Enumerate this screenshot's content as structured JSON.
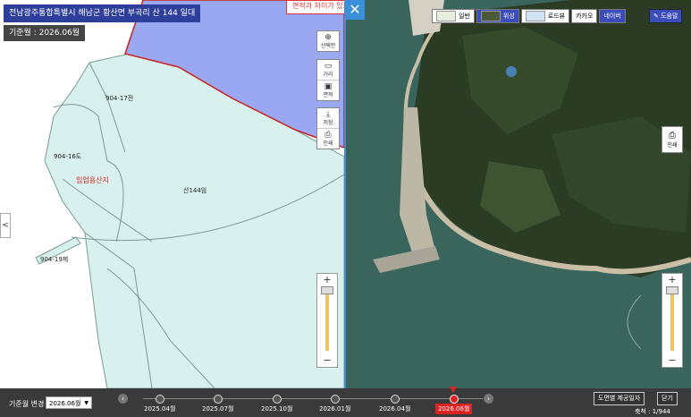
{
  "header": {
    "address": "전남광주통합특별시 해남군 황산면 부곡리 산 144 일대",
    "base_date": "기준월 : 2026.06월",
    "notice": "면적과 차이가 있으"
  },
  "left_tools": [
    {
      "name": "select-tool",
      "label": "선택안",
      "icon": "⊕"
    },
    {
      "name": "distance-tool",
      "label": "거리",
      "icon": "▭"
    },
    {
      "name": "area-tool",
      "label": "면적",
      "icon": "▣"
    },
    {
      "name": "save-tool",
      "label": "저장",
      "icon": "⤓"
    },
    {
      "name": "print-tool",
      "label": "인쇄",
      "icon": "⎙"
    }
  ],
  "map_labels": {
    "p1": "904-17전",
    "p2": "904-16도",
    "p3": "산144임",
    "p4": "904-19제",
    "zone": "임업용산지"
  },
  "map_types": [
    {
      "label": "일반",
      "thumb": "#e8ede0",
      "active": false
    },
    {
      "label": "위성",
      "thumb": "#4a5a3a",
      "active": true
    },
    {
      "label": "로드뷰",
      "thumb": "#cfe3f5",
      "active": false
    },
    {
      "label": "카카오",
      "thumb": "",
      "active": false
    },
    {
      "label": "네이버",
      "thumb": "",
      "active": true
    }
  ],
  "help_label": "도움말",
  "right_print_label": "인쇄",
  "zoom": {
    "plus": "+",
    "minus": "−"
  },
  "bottom": {
    "base_label": "기준월 변경",
    "select_value": "2026.06월",
    "timeline": [
      "2025.04월",
      "2025.07월",
      "2025.10월",
      "2026.01월",
      "2026.04월",
      "2026.06월"
    ],
    "active_index": 5,
    "provide_date_btn": "도면별 제공일자",
    "close_btn": "닫기",
    "scale": "축척 : 1/944"
  },
  "colors": {
    "parcel_fill": "#d8f1ee",
    "purple_area": "#9aa8f2",
    "header_blue": "#2e3f9b",
    "divider": "#3b8fd9",
    "active_red": "#d22222"
  },
  "icons": {
    "expand": "expand-icon",
    "left_arrow": "chevron-left-icon",
    "help": "help-pen-icon"
  }
}
